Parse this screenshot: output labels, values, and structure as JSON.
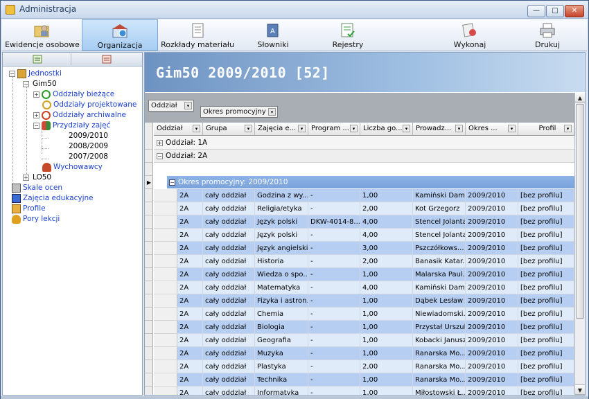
{
  "window": {
    "title": "Administracja"
  },
  "toolbar": {
    "items": [
      {
        "label": "Ewidencje osobowe"
      },
      {
        "label": "Organizacja",
        "active": true
      },
      {
        "label": "Rozkłady materiału"
      },
      {
        "label": "Słowniki"
      },
      {
        "label": "Rejestry"
      },
      {
        "label": "Wykonaj"
      },
      {
        "label": "Drukuj"
      }
    ]
  },
  "tree": {
    "items": [
      {
        "label": "Jednostki",
        "icon": "folder-icon"
      },
      {
        "label": "Gim50",
        "icon": "school-icon"
      },
      {
        "label": "Oddziały bieżące",
        "icon": "clock-green-icon"
      },
      {
        "label": "Oddziały projektowane",
        "icon": "clock-yellow-icon"
      },
      {
        "label": "Oddziały archiwalne",
        "icon": "clock-red-icon"
      },
      {
        "label": "Przydziały zajęć",
        "icon": "people-icon"
      },
      {
        "label": "2009/2010"
      },
      {
        "label": "2008/2009"
      },
      {
        "label": "2007/2008"
      },
      {
        "label": "Wychowawcy",
        "icon": "teacher-icon"
      },
      {
        "label": "LO50",
        "icon": "school-icon"
      },
      {
        "label": "Skale ocen",
        "icon": "scale-icon"
      },
      {
        "label": "Zajęcia edukacyjne",
        "icon": "book-icon"
      },
      {
        "label": "Profile",
        "icon": "profile-icon"
      },
      {
        "label": "Pory lekcji",
        "icon": "bell-icon"
      }
    ]
  },
  "main": {
    "banner_title": "Gim50 2009/2010 [52]",
    "group_chips": [
      "Oddział",
      "Okres promocyjny"
    ],
    "columns": [
      "Oddział",
      "Grupa",
      "Zajęcia e...",
      "Program ...",
      "Liczba go...",
      "Prowadz...",
      "Okres ...",
      "Profil"
    ],
    "groups": [
      "Oddział: 1A",
      "Oddział: 2A"
    ],
    "subgroup": "Okres promocyjny: 2009/2010",
    "rows": [
      [
        "2A",
        "cały oddział",
        "Godzina z wy...",
        "-",
        "1,00",
        "Kamiński Dam...",
        "2009/2010",
        "[bez profilu]"
      ],
      [
        "2A",
        "cały oddział",
        "Religia/etyka",
        "-",
        "2,00",
        "Kot Grzegorz",
        "2009/2010",
        "[bez profilu]"
      ],
      [
        "2A",
        "cały oddział",
        "Język polski",
        "DKW-4014-8...",
        "4,00",
        "Stencel Jolanta",
        "2009/2010",
        "[bez profilu]"
      ],
      [
        "2A",
        "cały oddział",
        "Język polski",
        "-",
        "4,00",
        "Stencel Jolanta",
        "2009/2010",
        "[bez profilu]"
      ],
      [
        "2A",
        "cały oddział",
        "Język angielski",
        "-",
        "3,00",
        "Pszczółkows...",
        "2009/2010",
        "[bez profilu]"
      ],
      [
        "2A",
        "cały oddział",
        "Historia",
        "-",
        "2,00",
        "Banasik Katar...",
        "2009/2010",
        "[bez profilu]"
      ],
      [
        "2A",
        "cały oddział",
        "Wiedza o spo...",
        "-",
        "1,00",
        "Malarska Paul...",
        "2009/2010",
        "[bez profilu]"
      ],
      [
        "2A",
        "cały oddział",
        "Matematyka",
        "-",
        "4,00",
        "Kamiński Dam...",
        "2009/2010",
        "[bez profilu]"
      ],
      [
        "2A",
        "cały oddział",
        "Fizyka i astron...",
        "-",
        "1,00",
        "Dąbek Lesław",
        "2009/2010",
        "[bez profilu]"
      ],
      [
        "2A",
        "cały oddział",
        "Chemia",
        "-",
        "1,00",
        "Niewiadomski...",
        "2009/2010",
        "[bez profilu]"
      ],
      [
        "2A",
        "cały oddział",
        "Biologia",
        "-",
        "1,00",
        "Przystał Urszula",
        "2009/2010",
        "[bez profilu]"
      ],
      [
        "2A",
        "cały oddział",
        "Geografia",
        "-",
        "1,00",
        "Kobacki Janusz",
        "2009/2010",
        "[bez profilu]"
      ],
      [
        "2A",
        "cały oddział",
        "Muzyka",
        "-",
        "1,00",
        "Ranarska Mo...",
        "2009/2010",
        "[bez profilu]"
      ],
      [
        "2A",
        "cały oddział",
        "Plastyka",
        "-",
        "2,00",
        "Ranarska Mo...",
        "2009/2010",
        "[bez profilu]"
      ],
      [
        "2A",
        "cały oddział",
        "Technika",
        "-",
        "1,00",
        "Ranarska Mo...",
        "2009/2010",
        "[bez profilu]"
      ],
      [
        "2A",
        "cały oddział",
        "Informatyka",
        "-",
        "1,00",
        "Miłostowski Ł...",
        "2009/2010",
        "[bez profilu]"
      ]
    ]
  }
}
